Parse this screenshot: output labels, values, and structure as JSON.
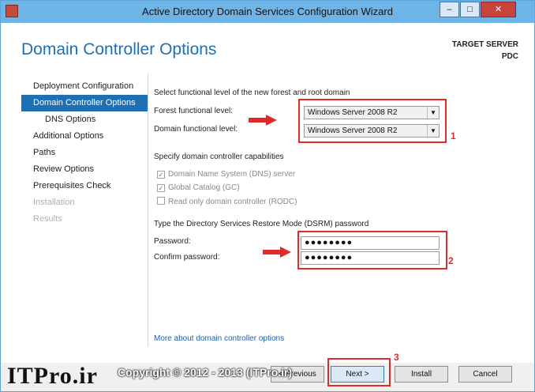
{
  "window": {
    "title": "Active Directory Domain Services Configuration Wizard",
    "minimize": "–",
    "maximize": "□",
    "close": "✕"
  },
  "header": {
    "title": "Domain Controller Options",
    "target_label": "TARGET SERVER",
    "target_value": "PDC"
  },
  "nav": {
    "items": [
      {
        "label": "Deployment Configuration"
      },
      {
        "label": "Domain Controller Options"
      },
      {
        "label": "DNS Options"
      },
      {
        "label": "Additional Options"
      },
      {
        "label": "Paths"
      },
      {
        "label": "Review Options"
      },
      {
        "label": "Prerequisites Check"
      },
      {
        "label": "Installation"
      },
      {
        "label": "Results"
      }
    ]
  },
  "main": {
    "functional_heading": "Select functional level of the new forest and root domain",
    "forest_label": "Forest functional level:",
    "forest_value": "Windows Server 2008 R2",
    "domain_label": "Domain functional level:",
    "domain_value": "Windows Server 2008 R2",
    "capabilities_heading": "Specify domain controller capabilities",
    "dns_label": "Domain Name System (DNS) server",
    "gc_label": "Global Catalog (GC)",
    "rodc_label": "Read only domain controller (RODC)",
    "dsrm_heading": "Type the Directory Services Restore Mode (DSRM) password",
    "password_label": "Password:",
    "password_value": "●●●●●●●●",
    "confirm_label": "Confirm password:",
    "confirm_value": "●●●●●●●●",
    "more_link": "More about domain controller options"
  },
  "annotations": {
    "n1": "1",
    "n2": "2",
    "n3": "3",
    "color": "#e02a2a"
  },
  "footer": {
    "previous": "< Previous",
    "next": "Next >",
    "install": "Install",
    "cancel": "Cancel"
  },
  "watermark": {
    "logo": "ITPro.ir",
    "copyright": "Copyright © 2012 - 2013 (ITPro.ir)"
  }
}
